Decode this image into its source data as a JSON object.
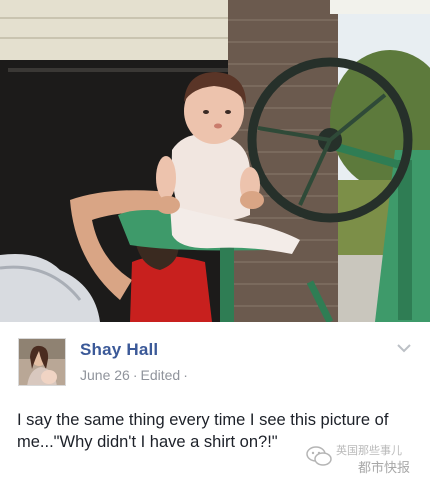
{
  "post": {
    "author_name": "Shay Hall",
    "date": "June 26",
    "edited_label": "Edited",
    "privacy_separator": "·",
    "text": "I say the same thing every time I see this picture of me...\"Why didn't I have a shirt on?!\""
  },
  "icons": {
    "options": "chevron-down-icon",
    "watermark": "wechat-logo-icon"
  },
  "watermark": {
    "line1": "英国那些事儿",
    "line2": "都市快报"
  },
  "colors": {
    "author_link": "#3b5998",
    "meta_text": "#90949c",
    "body_text": "#1d2129",
    "tractor_green": "#3e9a6a"
  }
}
